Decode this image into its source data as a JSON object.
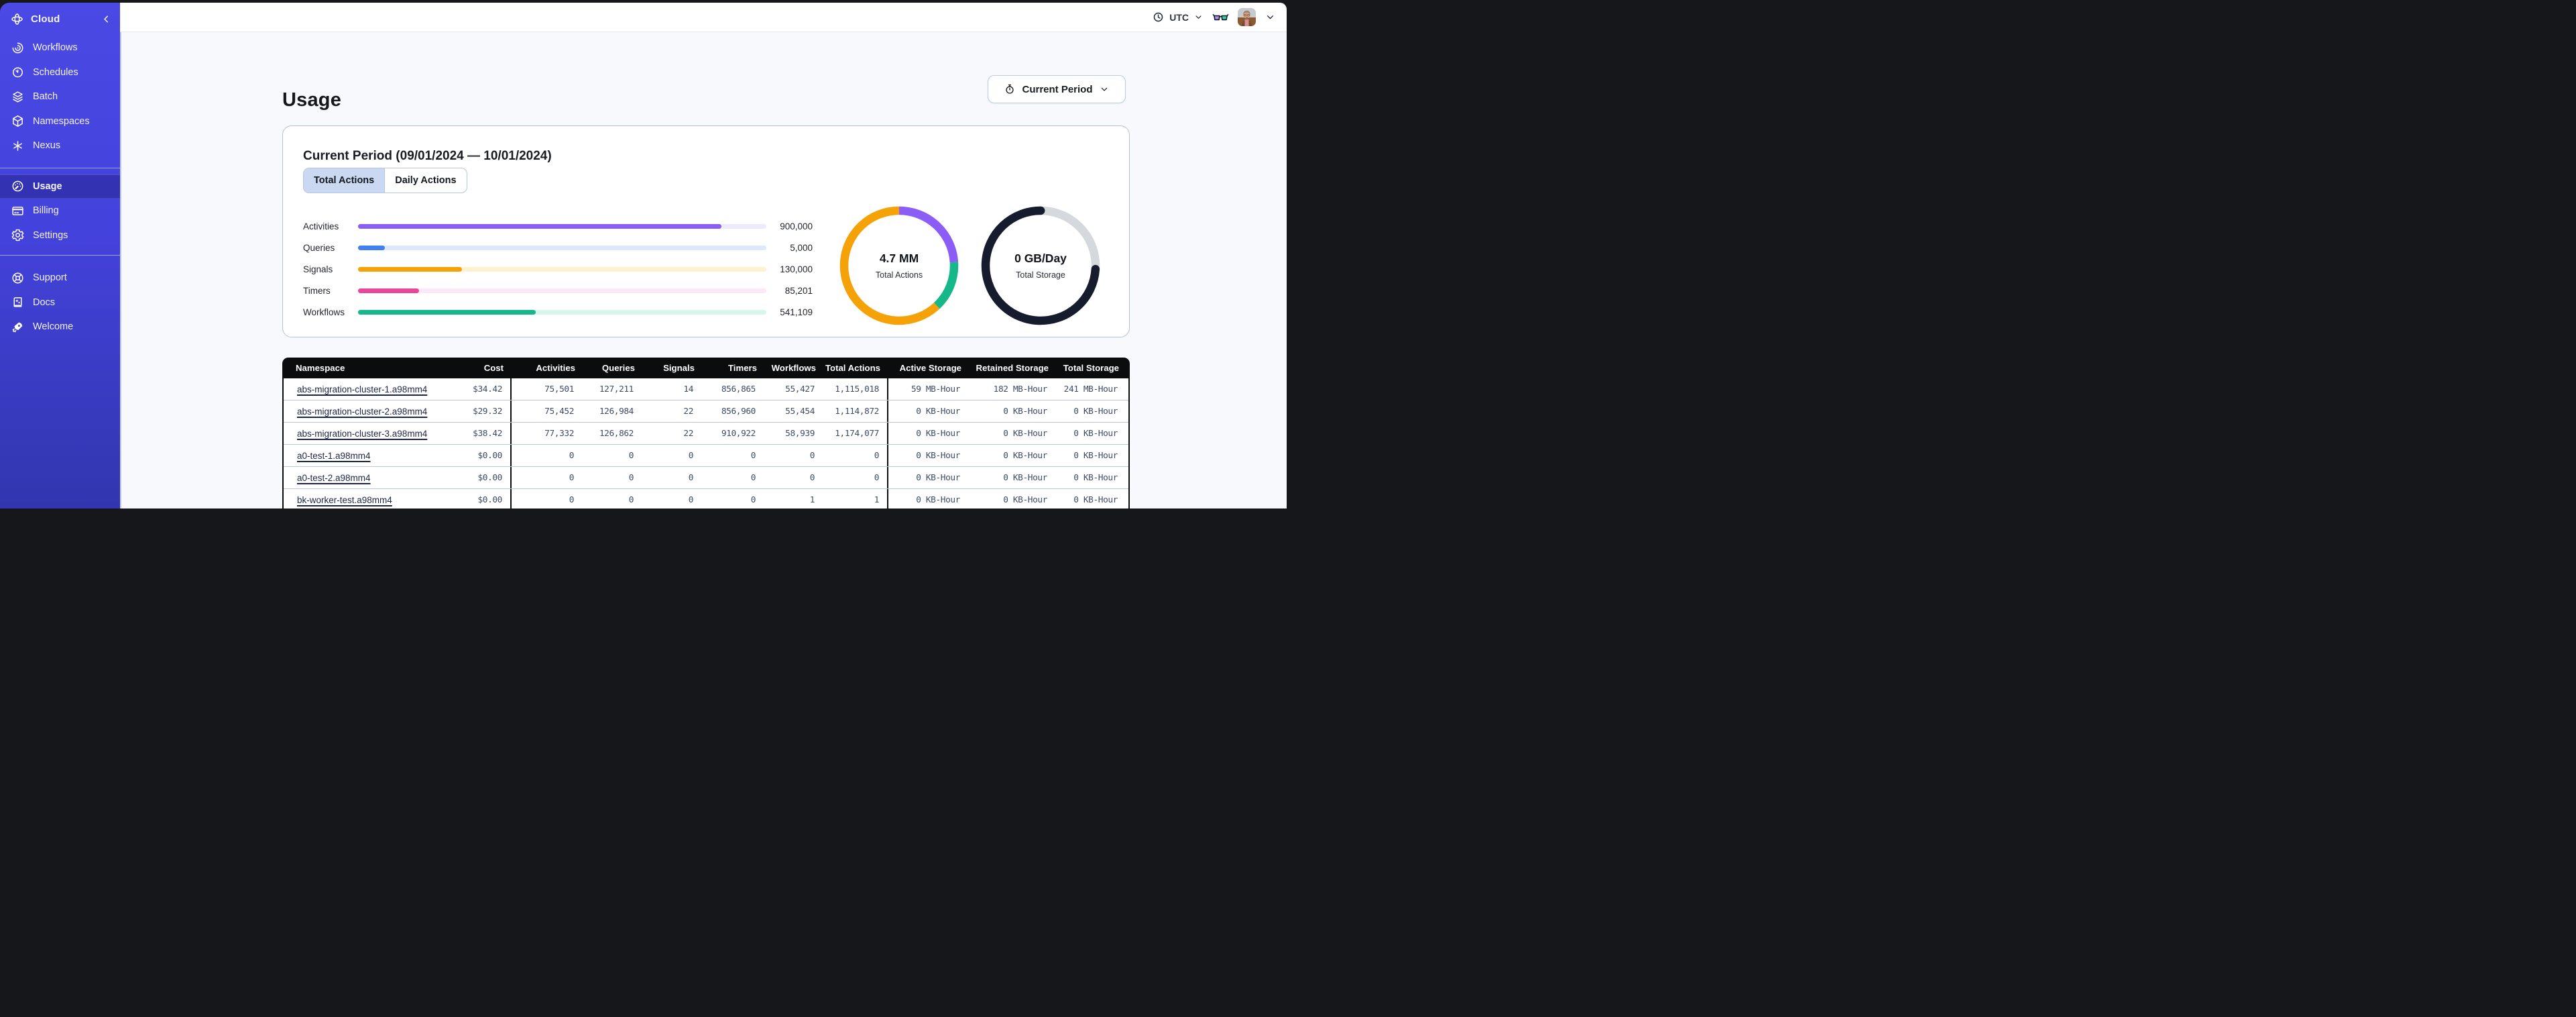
{
  "sidebar": {
    "logo_label": "Cloud",
    "colors": {
      "bg_top": "#4a49e4",
      "bg_bottom": "#3136ae"
    },
    "groups": [
      {
        "items": [
          {
            "id": "workflows",
            "label": "Workflows",
            "icon": "workflows-icon"
          },
          {
            "id": "schedules",
            "label": "Schedules",
            "icon": "schedules-icon"
          },
          {
            "id": "batch",
            "label": "Batch",
            "icon": "batch-icon"
          },
          {
            "id": "namespaces",
            "label": "Namespaces",
            "icon": "namespaces-icon"
          },
          {
            "id": "nexus",
            "label": "Nexus",
            "icon": "nexus-icon"
          }
        ]
      },
      {
        "items": [
          {
            "id": "usage",
            "label": "Usage",
            "icon": "usage-icon",
            "active": true
          },
          {
            "id": "billing",
            "label": "Billing",
            "icon": "billing-icon"
          },
          {
            "id": "settings",
            "label": "Settings",
            "icon": "settings-icon"
          }
        ]
      },
      {
        "items": [
          {
            "id": "support",
            "label": "Support",
            "icon": "support-icon"
          },
          {
            "id": "docs",
            "label": "Docs",
            "icon": "docs-icon"
          },
          {
            "id": "welcome",
            "label": "Welcome",
            "icon": "welcome-icon"
          }
        ]
      }
    ]
  },
  "header": {
    "timezone": "UTC"
  },
  "page": {
    "title": "Usage",
    "period_button_label": "Current Period"
  },
  "usage_card": {
    "title": "Current Period (09/01/2024 — 10/01/2024)",
    "tabs": [
      {
        "label": "Total Actions",
        "active": true
      },
      {
        "label": "Daily Actions",
        "active": false
      }
    ]
  },
  "chart_data": [
    {
      "type": "bar",
      "orientation": "horizontal",
      "categories": [
        "Activities",
        "Queries",
        "Signals",
        "Timers",
        "Workflows"
      ],
      "values": [
        900000,
        5000,
        130000,
        85201,
        541109
      ],
      "display_values": [
        "900,000",
        "5,000",
        "130,000",
        "85,201",
        "541,109"
      ],
      "fill_pct": [
        89,
        6.5,
        25.5,
        15,
        43.5
      ],
      "colors": [
        "#8b5cf6",
        "#4080f0",
        "#f5a208",
        "#e8479b",
        "#16b889"
      ],
      "track_colors": [
        "#eceafc",
        "#dce8fb",
        "#fcf2d0",
        "#fce9f6",
        "#d8f7ea"
      ],
      "grid": false,
      "legend": false
    },
    {
      "type": "pie",
      "style": "donut",
      "center_value": "4.7 MM",
      "center_label": "Total Actions",
      "segments": [
        {
          "name": "activities",
          "color": "#8b5cf6",
          "pct": 24
        },
        {
          "name": "workflows",
          "color": "#16b889",
          "pct": 14
        },
        {
          "name": "other",
          "color": "#f5a208",
          "pct": 62
        }
      ],
      "rounded_caps": false
    },
    {
      "type": "pie",
      "style": "donut",
      "center_value": "0 GB/Day",
      "center_label": "Total Storage",
      "segments": [
        {
          "name": "remaining",
          "color": "#d5d8dd",
          "pct": 26
        },
        {
          "name": "used",
          "color": "#161c2d",
          "pct": 74
        }
      ],
      "rounded_caps": true
    }
  ],
  "table": {
    "headers": [
      "Namespace",
      "Cost",
      "Activities",
      "Queries",
      "Signals",
      "Timers",
      "Workflows",
      "Total Actions",
      "Active Storage",
      "Retained Storage",
      "Total Storage"
    ],
    "rows": [
      {
        "namespace": "abs-migration-cluster-1.a98mm4",
        "cells": [
          "$34.42",
          "75,501",
          "127,211",
          "14",
          "856,865",
          "55,427",
          "1,115,018",
          "59 MB-Hour",
          "182 MB-Hour",
          "241 MB-Hour"
        ]
      },
      {
        "namespace": "abs-migration-cluster-2.a98mm4",
        "cells": [
          "$29.32",
          "75,452",
          "126,984",
          "22",
          "856,960",
          "55,454",
          "1,114,872",
          "0 KB-Hour",
          "0 KB-Hour",
          "0 KB-Hour"
        ]
      },
      {
        "namespace": "abs-migration-cluster-3.a98mm4",
        "cells": [
          "$38.42",
          "77,332",
          "126,862",
          "22",
          "910,922",
          "58,939",
          "1,174,077",
          "0 KB-Hour",
          "0 KB-Hour",
          "0 KB-Hour"
        ]
      },
      {
        "namespace": "a0-test-1.a98mm4",
        "cells": [
          "$0.00",
          "0",
          "0",
          "0",
          "0",
          "0",
          "0",
          "0 KB-Hour",
          "0 KB-Hour",
          "0 KB-Hour"
        ]
      },
      {
        "namespace": "a0-test-2.a98mm4",
        "cells": [
          "$0.00",
          "0",
          "0",
          "0",
          "0",
          "0",
          "0",
          "0 KB-Hour",
          "0 KB-Hour",
          "0 KB-Hour"
        ]
      },
      {
        "namespace": "bk-worker-test.a98mm4",
        "cells": [
          "$0.00",
          "0",
          "0",
          "0",
          "0",
          "1",
          "1",
          "0 KB-Hour",
          "0 KB-Hour",
          "0 KB-Hour"
        ]
      }
    ]
  }
}
